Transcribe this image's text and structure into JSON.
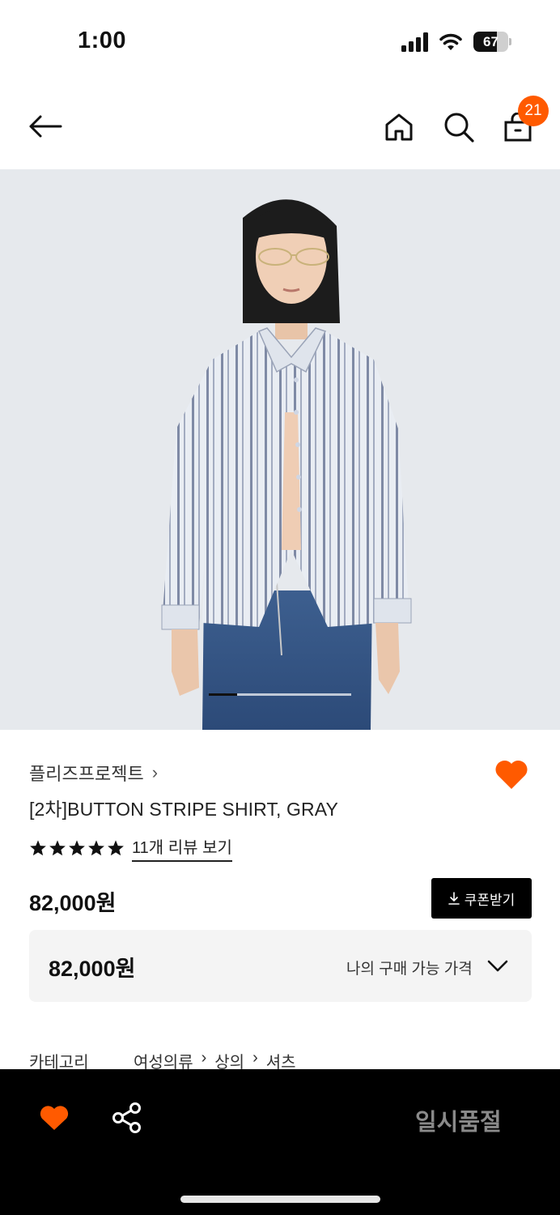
{
  "status_bar": {
    "time": "1:00",
    "battery": "67",
    "battery_level_percent": 67
  },
  "nav": {
    "back_icon": "arrow-left-icon",
    "home_icon": "home-icon",
    "search_icon": "search-icon",
    "cart_icon": "shopping-bag-icon",
    "cart_count": "21"
  },
  "product_image": {
    "pager_position": 1
  },
  "product": {
    "brand": "플리즈프로젝트",
    "brand_chevron": "›",
    "title": "[2차]BUTTON STRIPE SHIRT, GRAY",
    "rating_stars": 5,
    "review_link": "11개 리뷰 보기",
    "price": "82,000원",
    "coupon_button": "쿠폰받기",
    "my_price_value": "82,000원",
    "my_price_label": "나의 구매 가능 가격",
    "category_label": "카테고리",
    "category_path": [
      "여성의류",
      "상의",
      "셔츠"
    ]
  },
  "bottom_bar": {
    "sold_out": "일시품절"
  },
  "colors": {
    "accent": "#ff5a00",
    "bottom_bar": "#000000",
    "price_box": "#f4f4f4"
  }
}
